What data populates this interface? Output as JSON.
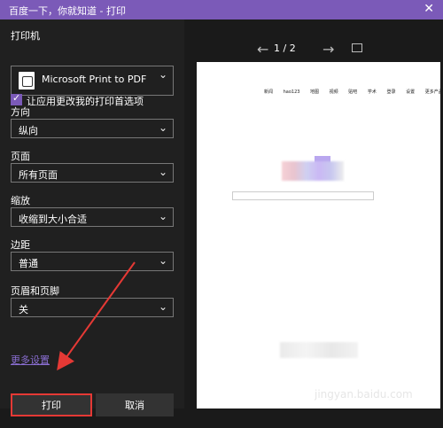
{
  "window": {
    "title": "百度一下，你就知道 - 打印",
    "close_icon": "close-icon"
  },
  "left_panel": {
    "printer_label": "打印机",
    "printer_value": "Microsoft Print to PDF",
    "checkbox_label": "让应用更改我的打印首选项",
    "orientation_label": "方向",
    "orientation_value": "纵向",
    "pages_label": "页面",
    "pages_value": "所有页面",
    "scale_label": "缩放",
    "scale_value": "收缩到大小合适",
    "margins_label": "边距",
    "margins_value": "普通",
    "header_footer_label": "页眉和页脚",
    "header_footer_value": "关",
    "more_settings": "更多设置",
    "print_button": "打印",
    "cancel_button": "取消"
  },
  "preview": {
    "page_counter": "1 / 2",
    "toolbar": [
      "←",
      "→",
      "fullscreen-icon"
    ],
    "top_links": [
      "新闻",
      "hao123",
      "地图",
      "视频",
      "贴吧",
      "学术",
      "登录",
      "设置",
      "更多产品"
    ]
  },
  "watermark": "jingyan.baidu.com"
}
